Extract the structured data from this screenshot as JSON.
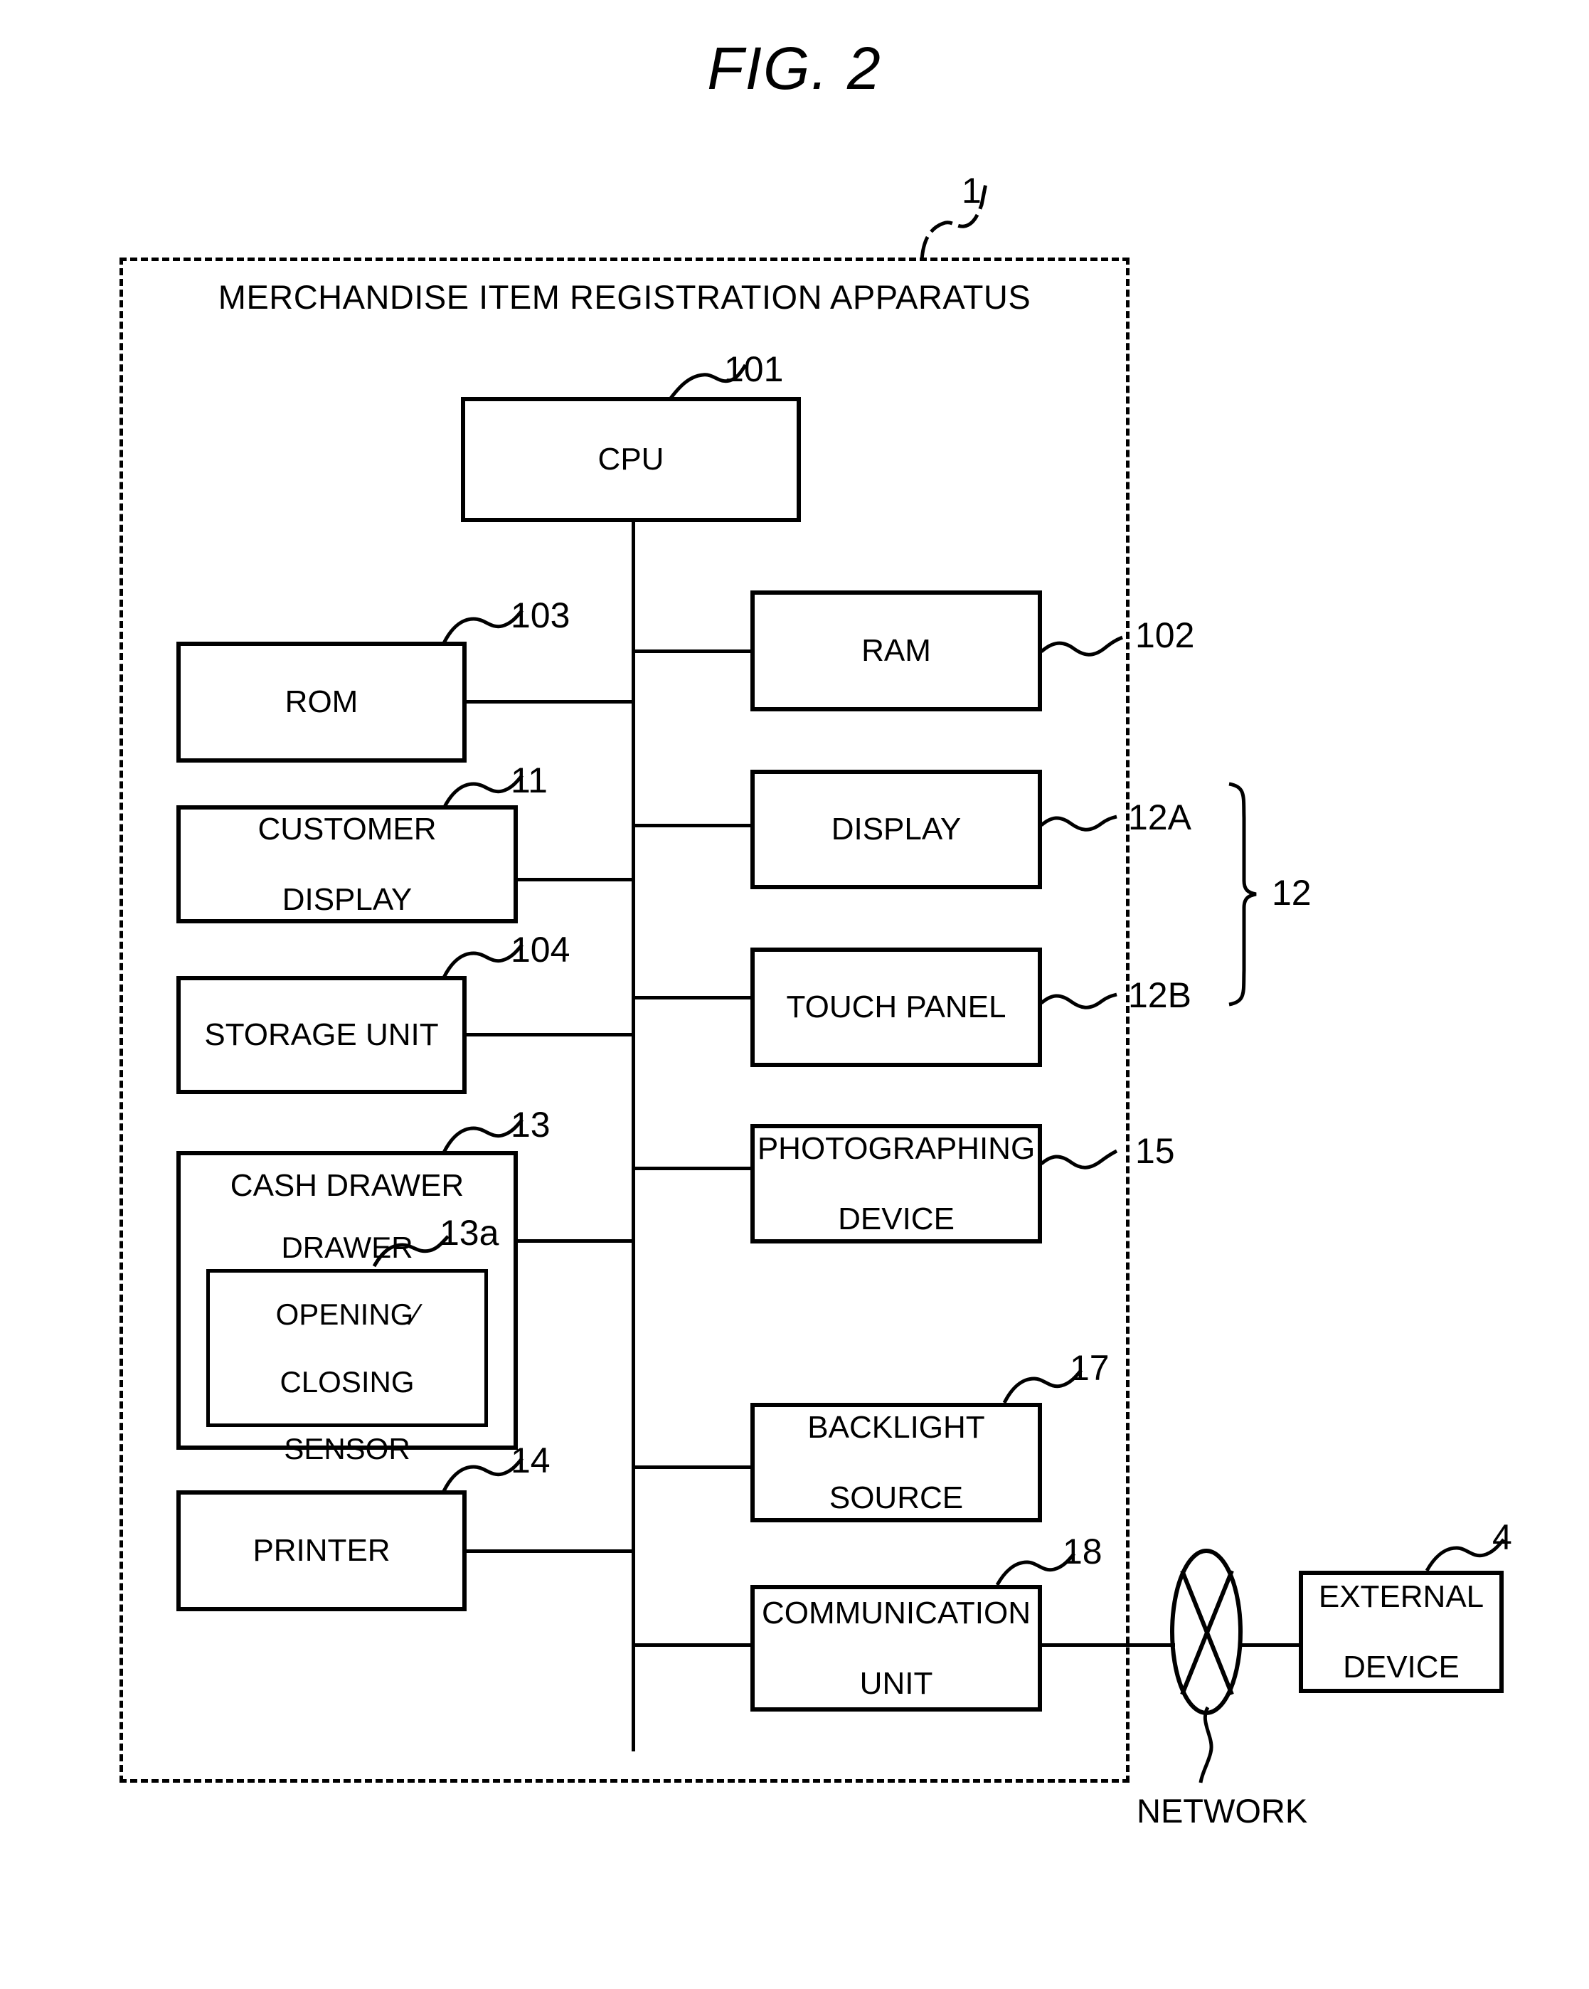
{
  "figure": {
    "title": "FIG. 2",
    "apparatus_label": "MERCHANDISE ITEM REGISTRATION APPARATUS",
    "apparatus_ref": "1"
  },
  "blocks": {
    "cpu": {
      "label": "CPU",
      "ref": "101"
    },
    "ram": {
      "label": "RAM",
      "ref": "102"
    },
    "rom": {
      "label": "ROM",
      "ref": "103"
    },
    "customer_display": {
      "label_line1": "CUSTOMER",
      "label_line2": "DISPLAY",
      "ref": "11"
    },
    "storage_unit": {
      "label": "STORAGE UNIT",
      "ref": "104"
    },
    "cash_drawer": {
      "label": "CASH DRAWER",
      "ref": "13"
    },
    "drawer_sensor": {
      "label_line1": "DRAWER",
      "label_line2": "OPENING∕",
      "label_line3": "CLOSING",
      "label_line4": "SENSOR",
      "ref": "13a"
    },
    "printer": {
      "label": "PRINTER",
      "ref": "14"
    },
    "display": {
      "label": "DISPLAY",
      "ref": "12A"
    },
    "touch_panel": {
      "label": "TOUCH PANEL",
      "ref": "12B"
    },
    "display_group_ref": "12",
    "photographing_device": {
      "label_line1": "PHOTOGRAPHING",
      "label_line2": "DEVICE",
      "ref": "15"
    },
    "backlight_source": {
      "label_line1": "BACKLIGHT",
      "label_line2": "SOURCE",
      "ref": "17"
    },
    "communication_unit": {
      "label_line1": "COMMUNICATION",
      "label_line2": "UNIT",
      "ref": "18"
    },
    "external_device": {
      "label_line1": "EXTERNAL",
      "label_line2": "DEVICE",
      "ref": "4"
    }
  },
  "network": {
    "label": "NETWORK"
  },
  "colors": {
    "ink": "#000000",
    "paper": "#ffffff"
  }
}
